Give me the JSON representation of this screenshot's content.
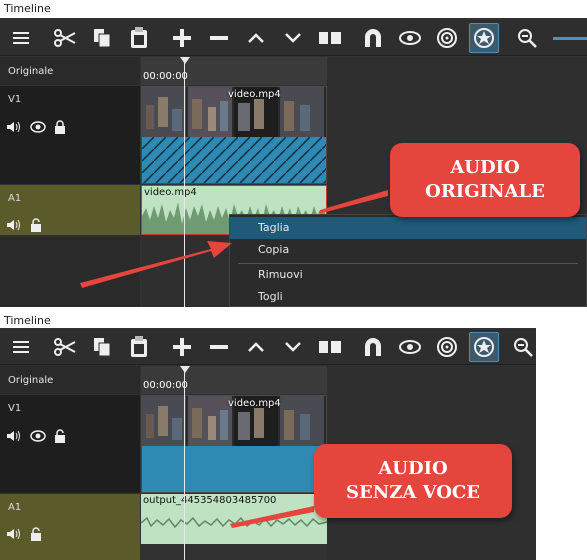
{
  "colors": {
    "accent": "#e4453d",
    "menu_highlight": "#1f5a78",
    "track_audio_header": "#5b5a2a",
    "audio_clip": "#bfe3c2",
    "video_clip_fill": "#2e8ab2"
  },
  "top": {
    "title": "Timeline",
    "toolbar_icons": [
      "menu-icon",
      "scissors-icon",
      "copy-icon",
      "paste-icon",
      "plus-icon",
      "minus-icon",
      "chevron-up-icon",
      "chevron-down-icon",
      "split-icon",
      "magnet-icon",
      "eye-icon",
      "target-icon",
      "ripple-icon",
      "zoom-out-icon"
    ],
    "original_label": "Originale",
    "timecode": "00:00:00",
    "v1": {
      "name": "V1",
      "clip_name": "video.mp4"
    },
    "a1": {
      "name": "A1",
      "clip_name": "video.mp4"
    },
    "context_menu": {
      "items": [
        "Taglia",
        "Copia",
        "Rimuovi",
        "Togli"
      ],
      "selected": "Taglia"
    },
    "callout": {
      "line1": "AUDIO",
      "line2": "ORIGINALE"
    }
  },
  "bottom": {
    "title": "Timeline",
    "original_label": "Originale",
    "timecode": "00:00:00",
    "v1": {
      "name": "V1",
      "clip_name": "video.mp4"
    },
    "a1": {
      "name": "A1",
      "clip_name": "output_445354803485700"
    },
    "callout": {
      "line1": "AUDIO",
      "line2": "SENZA VOCE"
    }
  }
}
